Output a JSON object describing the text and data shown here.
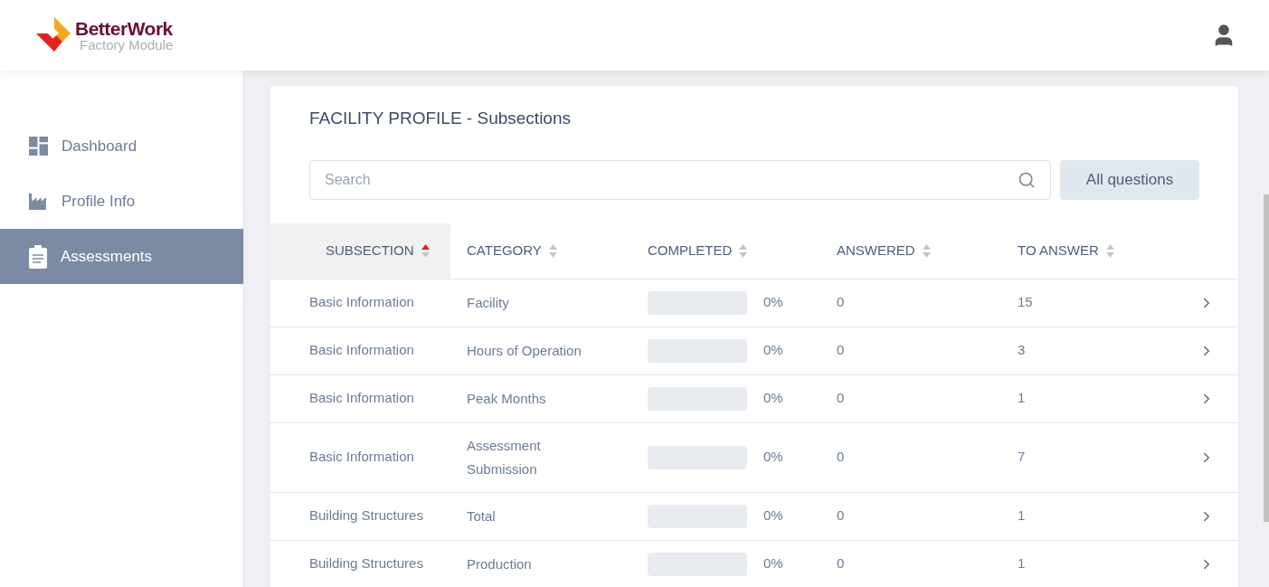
{
  "brand": {
    "name": "BetterWork",
    "subtitle": "Factory Module"
  },
  "sidebar": {
    "items": [
      {
        "label": "Dashboard",
        "kind": "dashboard",
        "selected": false
      },
      {
        "label": "Profile Info",
        "kind": "factory",
        "selected": false
      },
      {
        "label": "Assessments",
        "kind": "clipboard",
        "selected": true
      }
    ]
  },
  "card": {
    "title": "FACILITY PROFILE - Subsections",
    "search": {
      "placeholder": "Search"
    },
    "filter_button": "All questions"
  },
  "table": {
    "columns": [
      {
        "label": "SUBSECTION",
        "sorted": true
      },
      {
        "label": "CATEGORY",
        "sorted": false
      },
      {
        "label": "COMPLETED",
        "sorted": false
      },
      {
        "label": "ANSWERED",
        "sorted": false
      },
      {
        "label": "TO ANSWER",
        "sorted": false
      }
    ],
    "rows": [
      {
        "subsection": "Basic Information",
        "category": "Facility",
        "level": 0,
        "percent": "0%",
        "answered": "0",
        "to_answer": "15"
      },
      {
        "subsection": "Basic Information",
        "category": "Hours of Operation",
        "level": 0,
        "percent": "0%",
        "answered": "0",
        "to_answer": "3"
      },
      {
        "subsection": "Basic Information",
        "category": "Peak Months",
        "level": 0,
        "percent": "0%",
        "answered": "0",
        "to_answer": "1"
      },
      {
        "subsection": "Basic Information",
        "category": "Assessment Submission",
        "level": 0,
        "percent": "0%",
        "answered": "0",
        "to_answer": "7"
      },
      {
        "subsection": "Building Structures",
        "category": "Total",
        "level": 0,
        "percent": "0%",
        "answered": "0",
        "to_answer": "1"
      },
      {
        "subsection": "Building Structures",
        "category": "Production",
        "level": 0,
        "percent": "0%",
        "answered": "0",
        "to_answer": "1"
      }
    ]
  }
}
